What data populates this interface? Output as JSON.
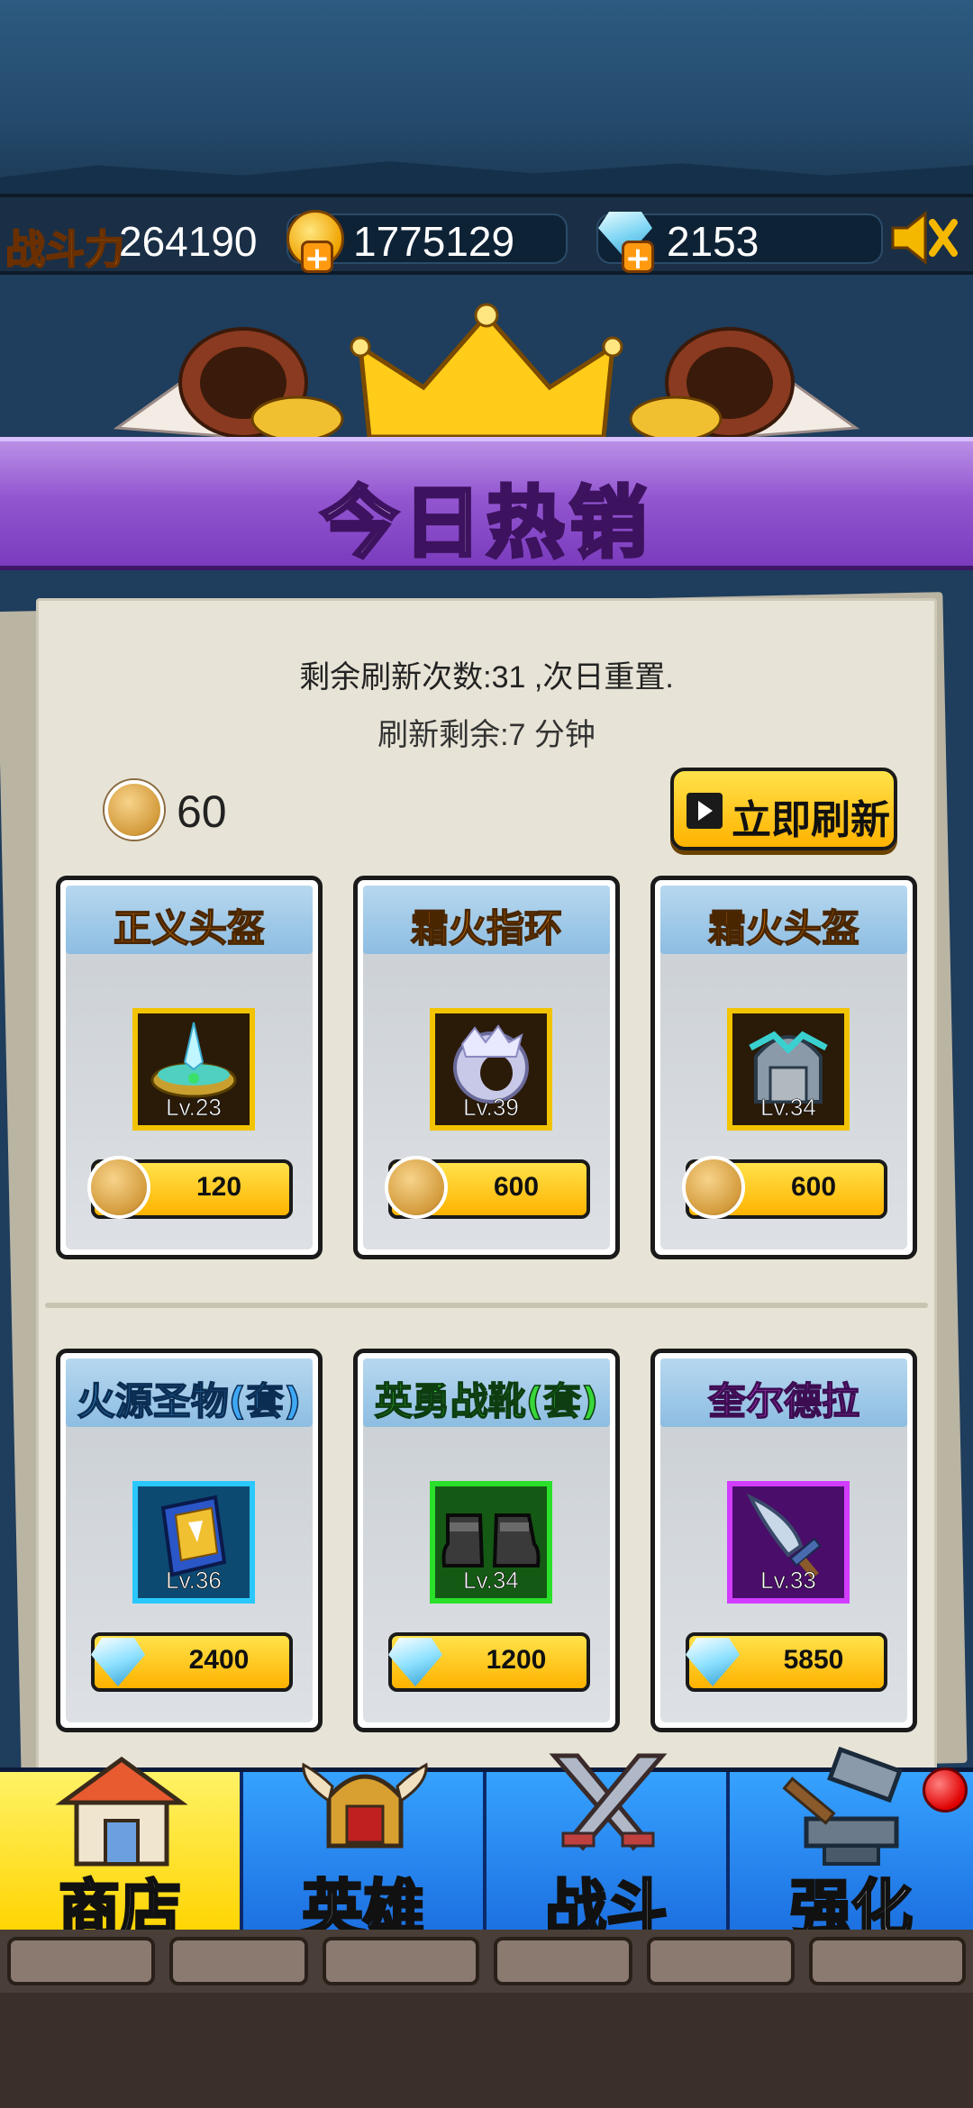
{
  "stats": {
    "power_label": "战斗力",
    "power_value": "264190",
    "gold_value": "1775129",
    "gem_value": "2153"
  },
  "banner": {
    "title": "今日热销"
  },
  "shop": {
    "refresh_info": "剩余刷新次数:31 ,次日重置.",
    "refresh_timer": "刷新剩余:7 分钟",
    "token_count": "60",
    "refresh_button": "立即刷新"
  },
  "items": [
    {
      "name": "正义头盔",
      "level": "Lv.23",
      "price": "120",
      "currency": "token",
      "rarity_color": "#f2c300",
      "icon": "helmet-crystal-icon"
    },
    {
      "name": "霜火指环",
      "level": "Lv.39",
      "price": "600",
      "currency": "token",
      "rarity_color": "#f2c300",
      "icon": "ring-icon"
    },
    {
      "name": "霜火头盔",
      "level": "Lv.34",
      "price": "600",
      "currency": "token",
      "rarity_color": "#f2c300",
      "icon": "helmet-icon"
    },
    {
      "name": "火源圣物(套)",
      "level": "Lv.36",
      "price": "2400",
      "currency": "gem",
      "rarity_color": "#2ac8ff",
      "icon": "book-icon"
    },
    {
      "name": "英勇战靴(套)",
      "level": "Lv.34",
      "price": "1200",
      "currency": "gem",
      "rarity_color": "#2ae02a",
      "icon": "boots-icon"
    },
    {
      "name": "奎尔德拉",
      "level": "Lv.33",
      "price": "5850",
      "currency": "gem",
      "rarity_color": "#d23cff",
      "icon": "sword-icon"
    }
  ],
  "nav": {
    "shop": "商店",
    "heroes": "英雄",
    "battle": "战斗",
    "upgrade": "强化"
  },
  "colors": {
    "banner_purple": "#9356d0",
    "button_yellow": "#ffd400",
    "nav_blue": "#1c6fe0"
  }
}
